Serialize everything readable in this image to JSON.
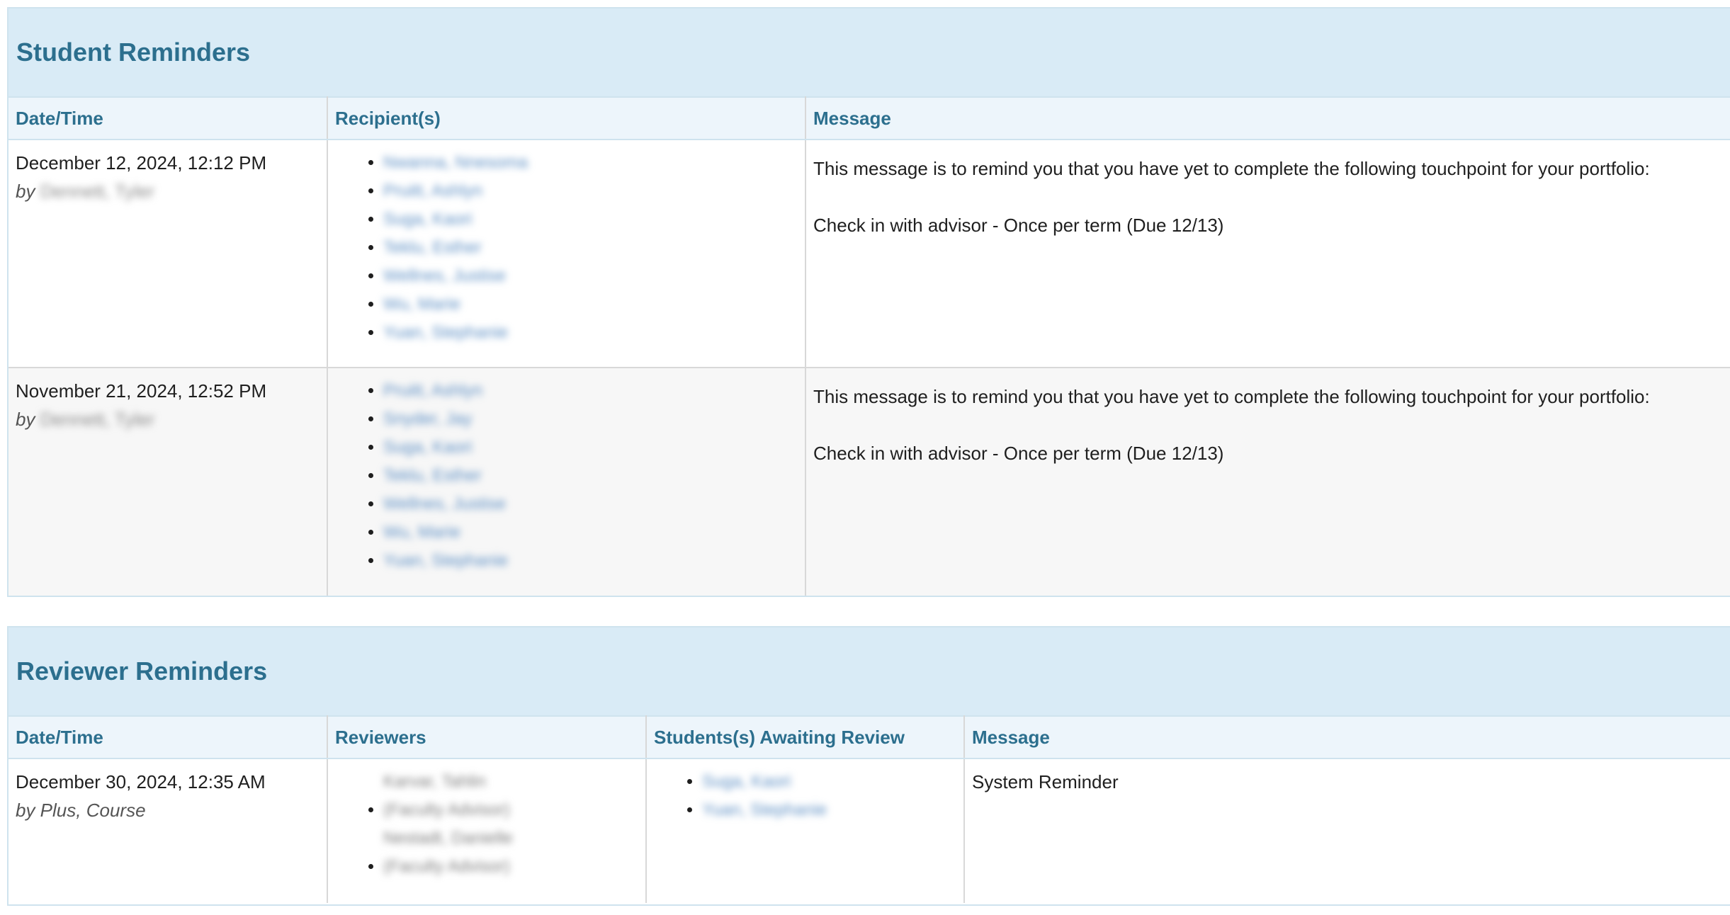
{
  "student_reminders": {
    "title": "Student Reminders",
    "columns": [
      "Date/Time",
      "Recipient(s)",
      "Message"
    ],
    "rows": [
      {
        "datetime": "December 12, 2024, 12:12 PM",
        "by_prefix": "by",
        "by_name": "Dennett, Tyler",
        "recipients": [
          "Nwanna, Nnesoma",
          "Pruitt, Ashlyn",
          "Suga, Kaori",
          "Teklu, Esther",
          "Wellnes, Justise",
          "Wu, Marie",
          "Yuan, Stephanie"
        ],
        "message_line1": "This message is to remind you that you have yet to complete the following touchpoint for your portfolio:",
        "message_line2": "Check in with advisor - Once per term (Due 12/13)"
      },
      {
        "datetime": "November 21, 2024, 12:52 PM",
        "by_prefix": "by",
        "by_name": "Dennett, Tyler",
        "recipients": [
          "Pruitt, Ashlyn",
          "Snyder, Jay",
          "Suga, Kaori",
          "Teklu, Esther",
          "Wellnes, Justise",
          "Wu, Marie",
          "Yuan, Stephanie"
        ],
        "message_line1": "This message is to remind you that you have yet to complete the following touchpoint for your portfolio:",
        "message_line2": "Check in with advisor - Once per term (Due 12/13)"
      }
    ]
  },
  "reviewer_reminders": {
    "title": "Reviewer Reminders",
    "columns": [
      "Date/Time",
      "Reviewers",
      "Students(s) Awaiting Review",
      "Message"
    ],
    "rows": [
      {
        "datetime": "December 30, 2024, 12:35 AM",
        "by_text": "by Plus, Course",
        "reviewers": [
          "Karvar, Tahlin (Faculty Advisor)",
          "Nestadt, Danielle (Faculty Advisor)"
        ],
        "students": [
          "Suga, Kaori",
          "Yuan, Stephanie"
        ],
        "message": "System Reminder"
      }
    ]
  }
}
